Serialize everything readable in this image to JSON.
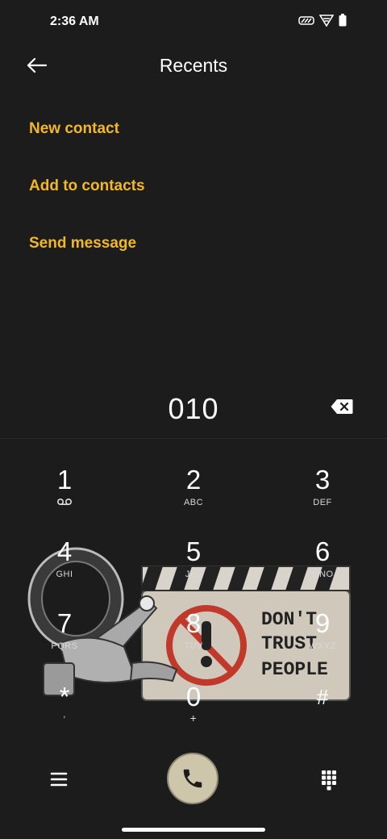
{
  "status_bar": {
    "time": "2:36 AM"
  },
  "header": {
    "title": "Recents"
  },
  "actions": {
    "new_contact": "New contact",
    "add_to_contacts": "Add to contacts",
    "send_message": "Send message"
  },
  "dialer": {
    "number": "010"
  },
  "keypad": [
    {
      "digit": "1",
      "letters": ""
    },
    {
      "digit": "2",
      "letters": "ABC"
    },
    {
      "digit": "3",
      "letters": "DEF"
    },
    {
      "digit": "4",
      "letters": "GHI"
    },
    {
      "digit": "5",
      "letters": "JKL"
    },
    {
      "digit": "6",
      "letters": "MNO"
    },
    {
      "digit": "7",
      "letters": "PQRS"
    },
    {
      "digit": "8",
      "letters": "TUV"
    },
    {
      "digit": "9",
      "letters": "WXYZ"
    },
    {
      "digit": "*",
      "letters": ","
    },
    {
      "digit": "0",
      "letters": "+"
    },
    {
      "digit": "#",
      "letters": ""
    }
  ],
  "sticker": {
    "text_line1": "DON'T",
    "text_line2": "TRUST",
    "text_line3": "PEOPLE"
  },
  "colors": {
    "accent": "#f2b824",
    "background": "#1c1c1c",
    "call_button": "#cdc6aa"
  },
  "icons": {
    "back": "arrow-left-icon",
    "backspace": "backspace-icon",
    "voicemail": "voicemail-icon",
    "menu": "menu-icon",
    "call": "phone-icon",
    "dialpad": "dialpad-icon"
  }
}
